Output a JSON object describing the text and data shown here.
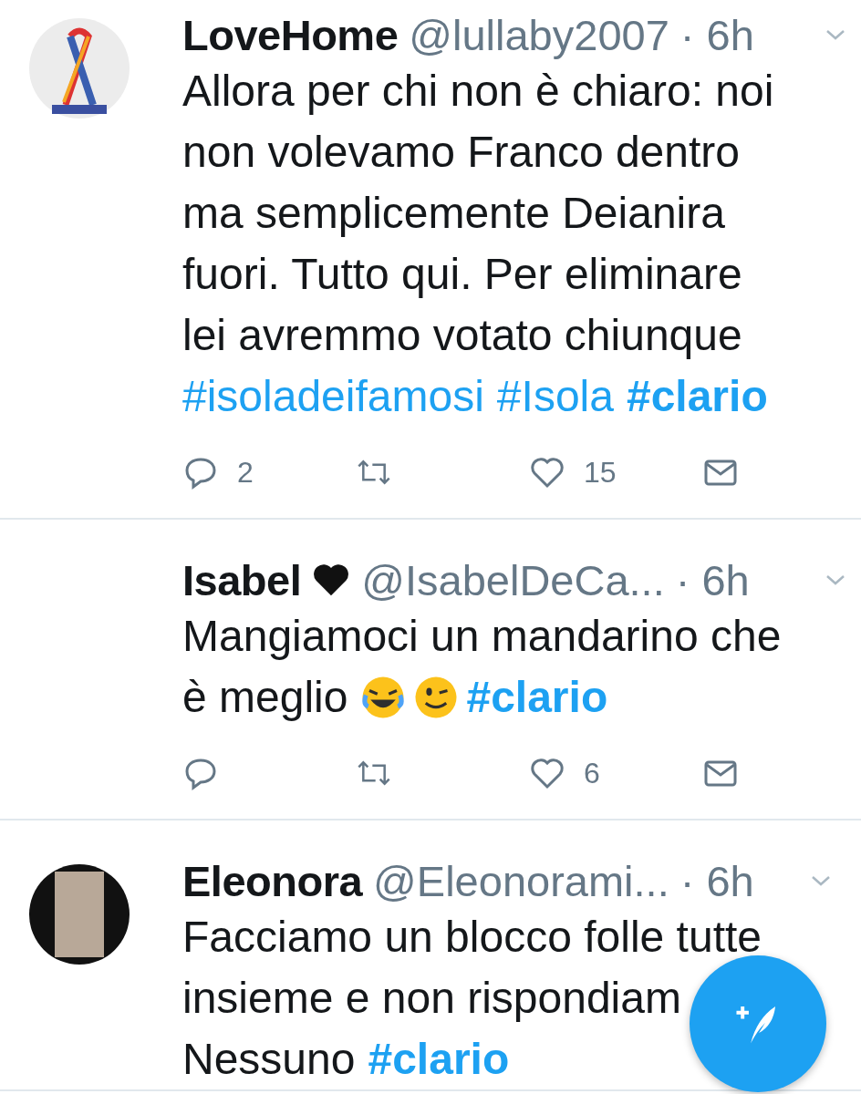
{
  "tweets": [
    {
      "avatar": {
        "kind": "ribbon"
      },
      "name": "LoveHome",
      "heart": false,
      "handle": "@lullaby2007",
      "time": "· 6h",
      "lines": [
        [
          {
            "kind": "text",
            "text": "Allora per chi non è chiaro: noi"
          }
        ],
        [
          {
            "kind": "text",
            "text": "non volevamo Franco dentro"
          }
        ],
        [
          {
            "kind": "text",
            "text": "ma semplicemente Deianira"
          }
        ],
        [
          {
            "kind": "text",
            "text": "fuori. Tutto qui. Per eliminare"
          }
        ],
        [
          {
            "kind": "text",
            "text": "lei avremmo votato chiunque"
          }
        ],
        [
          {
            "kind": "hashtag",
            "text": "#isoladeifamosi",
            "bold": false
          },
          {
            "kind": "hashtag",
            "text": "#Isola",
            "bold": false
          },
          {
            "kind": "hashtag",
            "text": "#clario",
            "bold": true
          }
        ]
      ],
      "actions": {
        "replies": "2",
        "likes": "15"
      }
    },
    {
      "name": "Isabel",
      "heart": true,
      "handle": "@IsabelDeCa...",
      "time": "· 6h",
      "lines": [
        [
          {
            "kind": "text",
            "text": "Mangiamoci un mandarino che"
          }
        ],
        [
          {
            "kind": "text",
            "text": "è meglio"
          },
          {
            "kind": "laugh-emoji"
          },
          {
            "kind": "wink-emoji"
          },
          {
            "kind": "hashtag",
            "text": "#clario",
            "bold": true
          }
        ]
      ],
      "actions": {
        "likes": "6"
      }
    },
    {
      "avatar": {
        "kind": "photo"
      },
      "name": "Eleonora",
      "heart": false,
      "handle": "@Eleonorami...",
      "time": "· 6h",
      "lines": [
        [
          {
            "kind": "text",
            "text": "Facciamo un blocco folle tutte"
          }
        ],
        [
          {
            "kind": "text",
            "text": "insieme e non rispondiam"
          }
        ],
        [
          {
            "kind": "text",
            "text": "Nessuno"
          },
          {
            "kind": "hashtag",
            "text": "#clario",
            "bold": true
          }
        ]
      ]
    }
  ]
}
